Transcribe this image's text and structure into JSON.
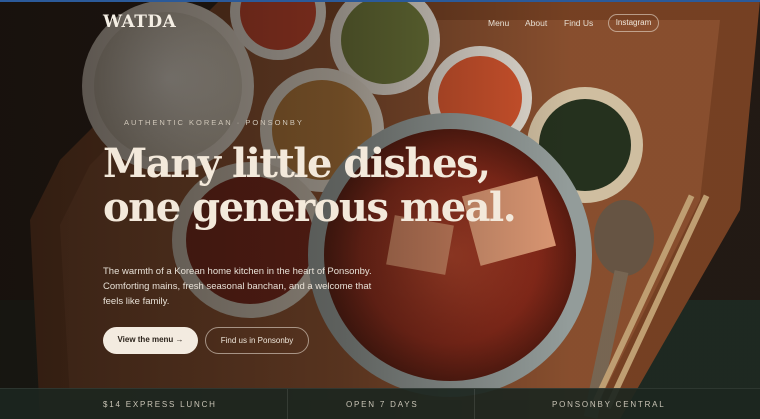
{
  "brand": {
    "logo": "WATDA"
  },
  "nav": {
    "links": [
      "Menu",
      "About",
      "Find Us"
    ],
    "instagram": "Instagram"
  },
  "hero": {
    "eyebrow": "AUTHENTIC KOREAN · PONSONBY",
    "headline_line1": "Many little dishes,",
    "headline_line2": "one generous meal.",
    "lede_line1": "The warmth of a Korean home kitchen in the heart of Ponsonby.",
    "lede_line2": "Comforting mains, fresh seasonal banchan, and a welcome that",
    "lede_line3": "feels like family.",
    "cta_primary": "View the menu →",
    "cta_secondary": "Find us in Ponsonby"
  },
  "strip": {
    "items": [
      "$14 EXPRESS LUNCH",
      "OPEN 7 DAYS",
      "PONSONBY CENTRAL"
    ]
  },
  "colors": {
    "accent_top_line": "#2b5a9a",
    "text_light": "#f3e9db",
    "button_fill": "#f3ebe0",
    "strip_bg": "#1c2620"
  }
}
